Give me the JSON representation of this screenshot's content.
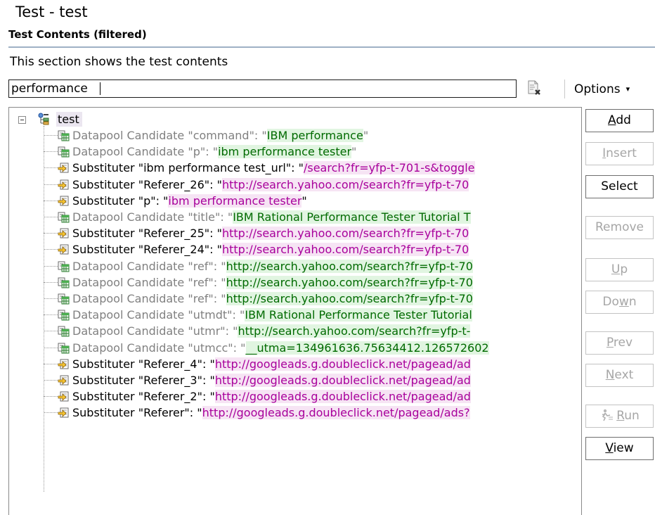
{
  "window": {
    "title": "Test - test"
  },
  "section": {
    "title": "Test Contents (filtered)",
    "description": "This section shows the test contents"
  },
  "filter": {
    "value": "performance",
    "clear_icon": "clear-filter-icon"
  },
  "options": {
    "label": "Options",
    "arrow": "▾"
  },
  "tree": {
    "root": {
      "label": "test",
      "icon": "test-icon",
      "expanded": true
    },
    "items": [
      {
        "type": "dp",
        "name": "Datapool Candidate \"command\": \"",
        "value": "IBM performance",
        "tail": "\"",
        "color": "green"
      },
      {
        "type": "dp",
        "name": "Datapool Candidate \"p\": \"",
        "value": "ibm performance tester",
        "tail": "\"",
        "color": "green"
      },
      {
        "type": "sub",
        "name": "Substituter \"ibm performance test_url\": \"",
        "value": "/search?fr=yfp-t-701-s&toggle",
        "tail": "",
        "color": "pink"
      },
      {
        "type": "sub",
        "name": "Substituter \"Referer_26\": \"",
        "value": "http://search.yahoo.com/search?fr=yfp-t-70",
        "tail": "",
        "color": "pink"
      },
      {
        "type": "sub",
        "name": "Substituter \"p\": \"",
        "value": "ibm performance tester",
        "tail": "\"",
        "color": "pink"
      },
      {
        "type": "dp",
        "name": "Datapool Candidate \"title\": \"",
        "value": "IBM Rational Performance Tester Tutorial T",
        "tail": "",
        "color": "green"
      },
      {
        "type": "sub",
        "name": "Substituter \"Referer_25\": \"",
        "value": "http://search.yahoo.com/search?fr=yfp-t-70",
        "tail": "",
        "color": "pink"
      },
      {
        "type": "sub",
        "name": "Substituter \"Referer_24\": \"",
        "value": "http://search.yahoo.com/search?fr=yfp-t-70",
        "tail": "",
        "color": "pink"
      },
      {
        "type": "dp",
        "name": "Datapool Candidate \"ref\": \"",
        "value": "http://search.yahoo.com/search?fr=yfp-t-70",
        "tail": "",
        "color": "green"
      },
      {
        "type": "dp",
        "name": "Datapool Candidate \"ref\": \"",
        "value": "http://search.yahoo.com/search?fr=yfp-t-70",
        "tail": "",
        "color": "green"
      },
      {
        "type": "dp",
        "name": "Datapool Candidate \"ref\": \"",
        "value": "http://search.yahoo.com/search?fr=yfp-t-70",
        "tail": "",
        "color": "green"
      },
      {
        "type": "dp",
        "name": "Datapool Candidate \"utmdt\": \"",
        "value": "IBM Rational Performance Tester Tutorial",
        "tail": "",
        "color": "green"
      },
      {
        "type": "dp",
        "name": "Datapool Candidate \"utmr\": \"",
        "value": "http://search.yahoo.com/search?fr=yfp-t-",
        "tail": "",
        "color": "green"
      },
      {
        "type": "dp",
        "name": "Datapool Candidate \"utmcc\": \"",
        "value": "__utma=134961636.75634412.126572602",
        "tail": "",
        "color": "green"
      },
      {
        "type": "sub",
        "name": "Substituter \"Referer_4\": \"",
        "value": "http://googleads.g.doubleclick.net/pagead/ad",
        "tail": "",
        "color": "pink"
      },
      {
        "type": "sub",
        "name": "Substituter \"Referer_3\": \"",
        "value": "http://googleads.g.doubleclick.net/pagead/ad",
        "tail": "",
        "color": "pink"
      },
      {
        "type": "sub",
        "name": "Substituter \"Referer_2\": \"",
        "value": "http://googleads.g.doubleclick.net/pagead/ad",
        "tail": "",
        "color": "pink"
      },
      {
        "type": "sub",
        "name": "Substituter \"Referer\": \"",
        "value": "http://googleads.g.doubleclick.net/pagead/ads?",
        "tail": "",
        "color": "pink"
      }
    ]
  },
  "buttons": [
    {
      "id": "add",
      "label": "Add",
      "mnemonic_index": 0,
      "enabled": true
    },
    {
      "id": "insert",
      "label": "Insert",
      "mnemonic_index": 0,
      "enabled": false
    },
    {
      "id": "select",
      "label": "Select",
      "mnemonic_index": -1,
      "enabled": true
    },
    {
      "id": "remove",
      "label": "Remove",
      "mnemonic_index": -1,
      "enabled": false
    },
    {
      "id": "up",
      "label": "Up",
      "mnemonic_index": 0,
      "enabled": false
    },
    {
      "id": "down",
      "label": "Down",
      "mnemonic_index": 2,
      "enabled": false
    },
    {
      "id": "prev",
      "label": "Prev",
      "mnemonic_index": 0,
      "enabled": false
    },
    {
      "id": "next",
      "label": "Next",
      "mnemonic_index": 0,
      "enabled": false
    },
    {
      "id": "run",
      "label": "Run",
      "mnemonic_index": 0,
      "enabled": false,
      "icon": "run-icon"
    },
    {
      "id": "view",
      "label": "View",
      "mnemonic_index": 0,
      "enabled": true
    }
  ],
  "colors": {
    "section_rule": "#9fb1c5",
    "value_green_bg": "#e1f5e1",
    "value_green_fg": "#006a00",
    "value_pink_bg": "#f6e4f4",
    "value_pink_fg": "#a8009b",
    "root_highlight": "#ebe6f0"
  }
}
